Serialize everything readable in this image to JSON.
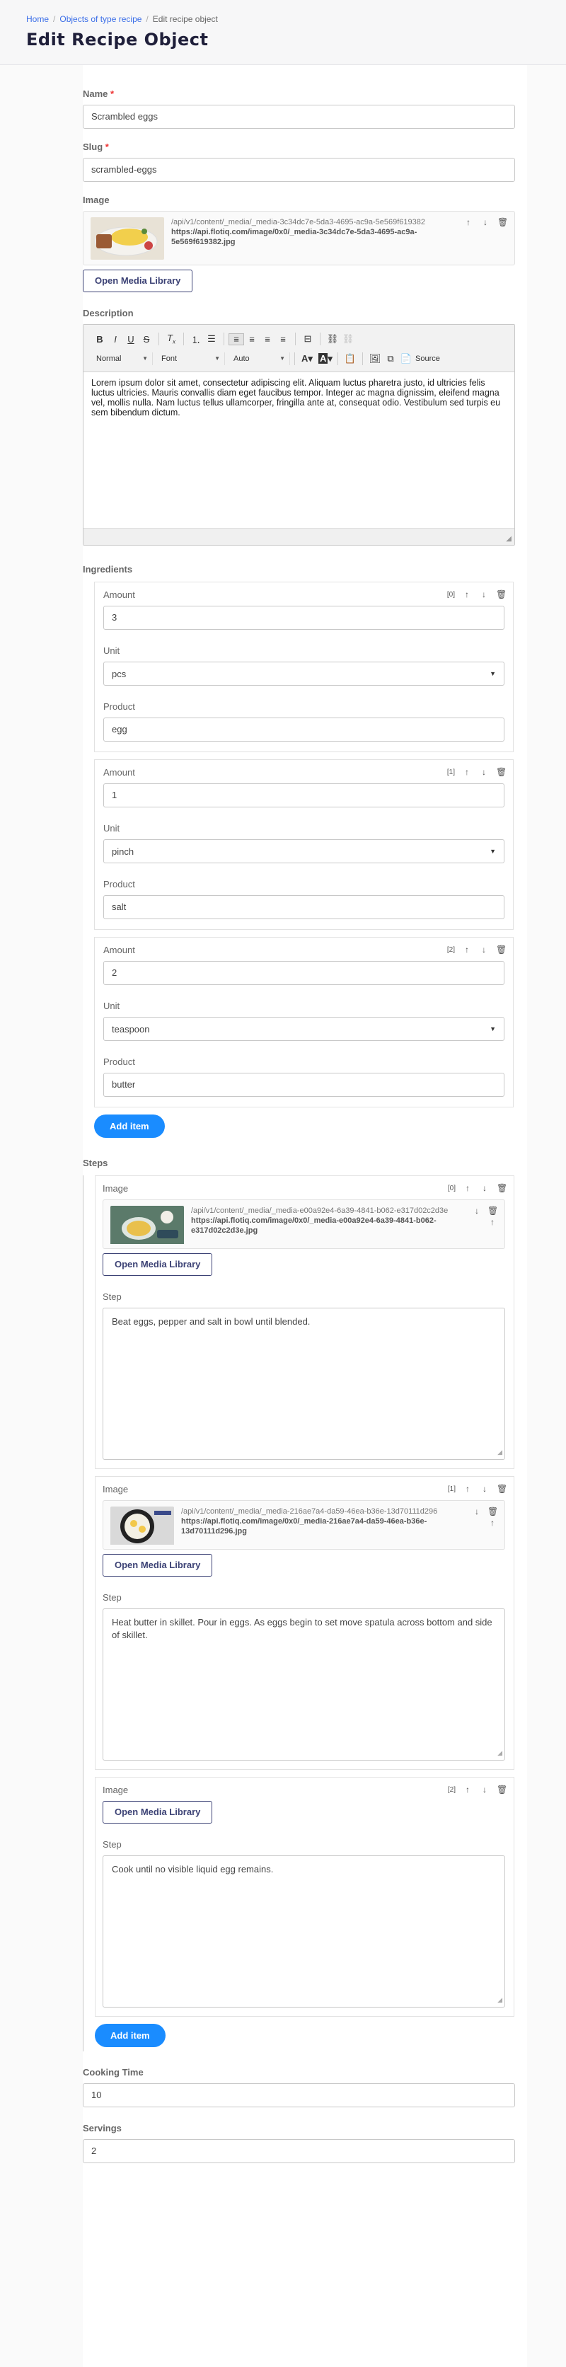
{
  "breadcrumb": {
    "home": "Home",
    "objects": "Objects of type recipe",
    "current": "Edit recipe object"
  },
  "page_title": "Edit Recipe Object",
  "name": {
    "label": "Name",
    "value": "Scrambled eggs"
  },
  "slug": {
    "label": "Slug",
    "value": "scrambled-eggs"
  },
  "image": {
    "label": "Image",
    "path": "/api/v1/content/_media/_media-3c34dc7e-5da3-4695-ac9a-5e569f619382",
    "url": "https://api.flotiq.com/image/0x0/_media-3c34dc7e-5da3-4695-ac9a-5e569f619382.jpg",
    "button": "Open Media Library"
  },
  "description": {
    "label": "Description",
    "format": "Normal",
    "font": "Font",
    "size": "Auto",
    "source": "Source",
    "text": "Lorem ipsum dolor sit amet, consectetur adipiscing elit. Aliquam luctus pharetra justo, id ultricies felis luctus ultricies. Mauris convallis diam eget faucibus tempor. Integer ac magna dignissim, eleifend magna vel, mollis nulla. Nam luctus tellus ullamcorper, fringilla ante at, consequat odio. Vestibulum sed turpis eu sem bibendum dictum."
  },
  "ingredients": {
    "label": "Ingredients",
    "add_label": "Add item",
    "items": [
      {
        "index": "[0]",
        "amount_label": "Amount",
        "amount": "3",
        "unit_label": "Unit",
        "unit": "pcs",
        "product_label": "Product",
        "product": "egg"
      },
      {
        "index": "[1]",
        "amount_label": "Amount",
        "amount": "1",
        "unit_label": "Unit",
        "unit": "pinch",
        "product_label": "Product",
        "product": "salt"
      },
      {
        "index": "[2]",
        "amount_label": "Amount",
        "amount": "2",
        "unit_label": "Unit",
        "unit": "teaspoon",
        "product_label": "Product",
        "product": "butter"
      }
    ]
  },
  "steps": {
    "label": "Steps",
    "add_label": "Add item",
    "items": [
      {
        "index": "[0]",
        "image_label": "Image",
        "path": "/api/v1/content/_media/_media-e00a92e4-6a39-4841-b062-e317d02c2d3e",
        "url": "https://api.flotiq.com/image/0x0/_media-e00a92e4-6a39-4841-b062-e317d02c2d3e.jpg",
        "button": "Open Media Library",
        "step_label": "Step",
        "step": "Beat eggs, pepper and salt in bowl until blended."
      },
      {
        "index": "[1]",
        "image_label": "Image",
        "path": "/api/v1/content/_media/_media-216ae7a4-da59-46ea-b36e-13d70111d296",
        "url": "https://api.flotiq.com/image/0x0/_media-216ae7a4-da59-46ea-b36e-13d70111d296.jpg",
        "button": "Open Media Library",
        "step_label": "Step",
        "step": "Heat butter in skillet. Pour in eggs. As eggs begin to set move spatula across bottom and side of skillet."
      },
      {
        "index": "[2]",
        "image_label": "Image",
        "button": "Open Media Library",
        "step_label": "Step",
        "step": "Cook until no visible liquid egg remains."
      }
    ]
  },
  "cooking_time": {
    "label": "Cooking Time",
    "value": "10"
  },
  "servings": {
    "label": "Servings",
    "value": "2"
  },
  "colors": {
    "accent": "#1a8cff",
    "link": "#3b6ee8",
    "title": "#1f1f3a",
    "outline": "#3c4275"
  },
  "icons": {
    "up": "arrow-up-icon",
    "down": "arrow-down-icon",
    "delete": "trash-icon",
    "caret": "chevron-down-icon"
  }
}
